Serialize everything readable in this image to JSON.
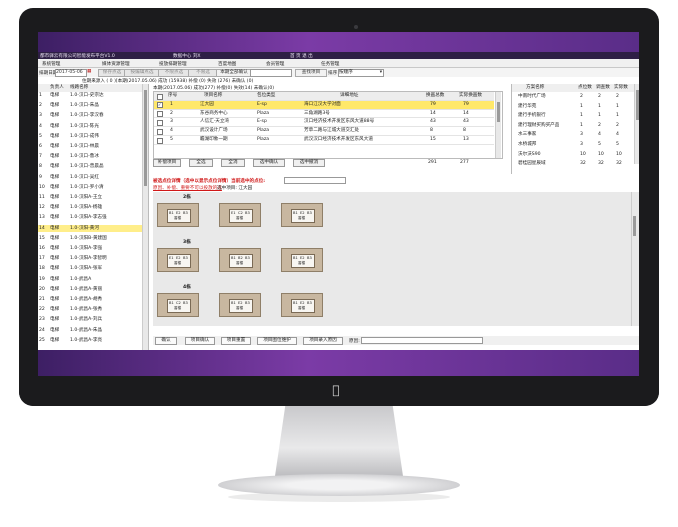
{
  "app": {
    "title_left": "都市驿云有限公司智能发布平台V1.0",
    "title_center": "数据中心 刘X",
    "title_right": "首 页 退 出"
  },
  "menu": [
    "系统管理",
    "媒体资源管理",
    "投放排期管理",
    "百度地图",
    "会员管理",
    "任务管理"
  ],
  "toolbar": {
    "date_label": "排期日期:",
    "date_value": "2017-05-06",
    "buttons": [
      "保存点选",
      "按编辑点选",
      "不限点选",
      "不限选",
      "本期全部确认"
    ],
    "search_button": "查找项目",
    "sort_label": "排序",
    "sort_value": "按顺序"
  },
  "infobar": {
    "left": "住期来源入 ( 0 )[本期(2017.05.06) 成功 (15938) 补偿 (0) 失效 (276) 未确认 (0)",
    "center": "本期(2017.05.06) 成功(277) 补偿(0) 失效(14) 未确认(0)"
  },
  "left_table": {
    "headers": [
      "负责人",
      "线路名称"
    ],
    "rows": [
      {
        "n": "1",
        "a": "电梯",
        "b": "1.0-汉口-史宗达"
      },
      {
        "n": "2",
        "a": "电梯",
        "b": "1.0-汉口-朱晶"
      },
      {
        "n": "3",
        "a": "电梯",
        "b": "1.0-汉口-李汉春"
      },
      {
        "n": "4",
        "a": "电梯",
        "b": "1.0-汉口-陈光"
      },
      {
        "n": "5",
        "a": "电梯",
        "b": "1.0-汉口-成伟"
      },
      {
        "n": "6",
        "a": "电梯",
        "b": "1.0-汉口-林晨"
      },
      {
        "n": "7",
        "a": "电梯",
        "b": "1.0-汉口-鲁冰"
      },
      {
        "n": "8",
        "a": "电梯",
        "b": "1.0-汉口-曾晨晶"
      },
      {
        "n": "9",
        "a": "电梯",
        "b": "1.0-汉口-吴红"
      },
      {
        "n": "10",
        "a": "电梯",
        "b": "1.0-汉口-罗小清"
      },
      {
        "n": "11",
        "a": "电梯",
        "b": "1.0-汉阳A-王立"
      },
      {
        "n": "12",
        "a": "电梯",
        "b": "1.0-汉阳A-杨雄"
      },
      {
        "n": "13",
        "a": "电梯",
        "b": "1.0-汉阳A-李志强"
      },
      {
        "n": "14",
        "a": "电梯",
        "b": "1.0-汉阳-黄河"
      },
      {
        "n": "15",
        "a": "电梯",
        "b": "1.0-汉阳B-黄建国"
      },
      {
        "n": "16",
        "a": "电梯",
        "b": "1.0-汉阳A-李强"
      },
      {
        "n": "17",
        "a": "电梯",
        "b": "1.0-汉阳A-李智明"
      },
      {
        "n": "18",
        "a": "电梯",
        "b": "1.0-汉阳A-张军"
      },
      {
        "n": "19",
        "a": "电梯",
        "b": "1.0-武昌A"
      },
      {
        "n": "20",
        "a": "电梯",
        "b": "1.0-武昌A-黄丽"
      },
      {
        "n": "21",
        "a": "电梯",
        "b": "1.0-武昌A-胡秀"
      },
      {
        "n": "22",
        "a": "电梯",
        "b": "1.0-武昌A-张秀"
      },
      {
        "n": "23",
        "a": "电梯",
        "b": "1.0-武昌A-刘兵"
      },
      {
        "n": "24",
        "a": "电梯",
        "b": "1.0-武昌A-朱晶"
      },
      {
        "n": "25",
        "a": "电梯",
        "b": "1.0-武昌A-李亮"
      }
    ]
  },
  "project_grid": {
    "headers": [
      "序号",
      "项目名称",
      "包位类型",
      "详细地址",
      "换画总数",
      "实际换画数"
    ],
    "rows": [
      {
        "n": "1",
        "name": "江大园",
        "type": "E-sp",
        "addr": "海口江汉大学对面",
        "total": "79",
        "actual": "79"
      },
      {
        "n": "2",
        "name": "东谷商务中心",
        "type": "Plaza",
        "addr": "三角湖路3号",
        "total": "14",
        "actual": "14"
      },
      {
        "n": "3",
        "name": "人信汇·天立湾",
        "type": "E-sp",
        "addr": "汉口经济技术开发区东风大道88号",
        "total": "43",
        "actual": "43"
      },
      {
        "n": "4",
        "name": "武汉设计广场",
        "type": "Plaza",
        "addr": "芳草二路与江城大道交汇处",
        "total": "8",
        "actual": "8"
      },
      {
        "n": "5",
        "name": "瞻湖印象一期",
        "type": "Plaza",
        "addr": "武汉汉口经济技术开发区东风大道",
        "total": "15",
        "actual": "13"
      }
    ],
    "totals": [
      "291",
      "277"
    ]
  },
  "grid_buttons": [
    "补偿项目",
    "全选",
    "全消",
    "选中确认",
    "选中撤消"
  ],
  "right_table": {
    "headers": [
      "方案名称",
      "点位数",
      "调查数",
      "实际数"
    ],
    "rows": [
      {
        "name": "中南时代广场",
        "a": "2",
        "b": "2",
        "c": "2"
      },
      {
        "name": "建行华苑",
        "a": "1",
        "b": "1",
        "c": "1"
      },
      {
        "name": "建行手机银行",
        "a": "1",
        "b": "1",
        "c": "1"
      },
      {
        "name": "建行理财买购买产品",
        "a": "1",
        "b": "2",
        "c": "2"
      },
      {
        "name": "水三事家",
        "a": "3",
        "b": "4",
        "c": "4"
      },
      {
        "name": "水桥城邦",
        "a": "3",
        "b": "5",
        "c": "5"
      },
      {
        "name": "沃尔沃S90",
        "a": "10",
        "b": "10",
        "c": "10"
      },
      {
        "name": "碧桂园星辰域",
        "a": "32",
        "b": "32",
        "c": "32"
      }
    ]
  },
  "detail_header": {
    "line1": "被选点位详情（选中以显示点位详情）当前选中的点位:",
    "line2_a": "原因、补偿、重要不可以投放的选",
    "line2_b": "选中项目: 江大园"
  },
  "buildings": [
    {
      "label": "2栋",
      "units": [
        [
          "B1",
          "E2",
          "B3"
        ],
        [
          "E1",
          "C2",
          "B3"
        ],
        [
          "B1",
          "E2",
          "B3"
        ]
      ]
    },
    {
      "label": "3栋",
      "units": [
        [
          "E1",
          "E2",
          "B3"
        ],
        [
          "B1",
          "B2",
          "B3"
        ],
        [
          "B1",
          "E2",
          "B3"
        ]
      ]
    },
    {
      "label": "4栋",
      "units": [
        [
          "B1",
          "C2",
          "B3"
        ],
        [
          "B1",
          "E2",
          "B3"
        ],
        [
          "B1",
          "E2",
          "B3"
        ]
      ]
    }
  ],
  "room_status": "香楼",
  "bottom_buttons": [
    "确认",
    "项目确认",
    "项目重置",
    "项目图位维护",
    "项目录入原因"
  ],
  "bottom_reason_label": "原因:",
  "colors": {
    "purple": "#7b3ba6",
    "selected_row": "#ffe86a",
    "red_text": "#d01818"
  }
}
